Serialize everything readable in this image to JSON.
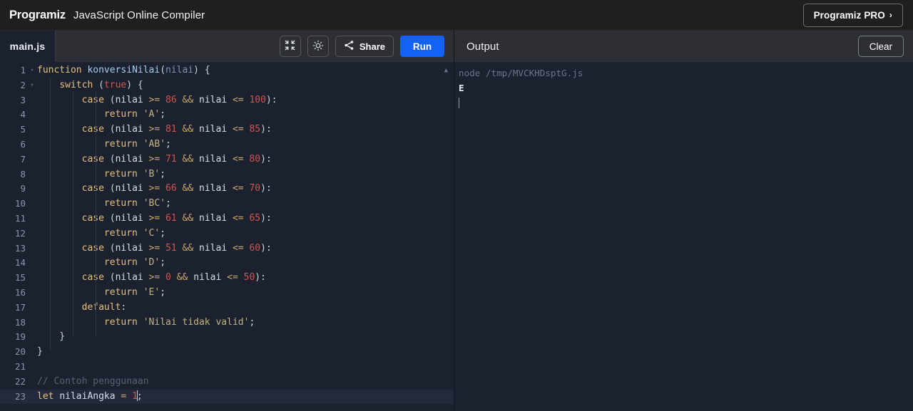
{
  "header": {
    "logo_text": "Programiz",
    "logo_icon": "programiz-flag-logo",
    "app_title": "JavaScript Online Compiler",
    "pro_button": "Programiz PRO",
    "pro_chevron": "›"
  },
  "editor_toolbar": {
    "file_tab": "main.js",
    "collapse_icon": "collapse-arrows-icon",
    "theme_icon": "brightness-sun-icon",
    "share_label": "Share",
    "share_icon": "share-nodes-icon",
    "run_label": "Run"
  },
  "output_panel": {
    "title": "Output",
    "clear_label": "Clear",
    "command_line": "node /tmp/MVCKHDsptG.js",
    "result_line": "E"
  },
  "editor": {
    "language": "javascript",
    "active_line": 23,
    "total_lines": 23,
    "lines": [
      {
        "n": 1,
        "fold": "▾",
        "tokens": [
          {
            "t": "function",
            "c": "kw"
          },
          {
            "t": " ",
            "c": "pun"
          },
          {
            "t": "konversiNilai",
            "c": "fn"
          },
          {
            "t": "(",
            "c": "pun"
          },
          {
            "t": "nilai",
            "c": "par"
          },
          {
            "t": ") {",
            "c": "pun"
          }
        ]
      },
      {
        "n": 2,
        "fold": "▾",
        "tokens": [
          {
            "t": "    ",
            "c": "pun"
          },
          {
            "t": "switch",
            "c": "kw"
          },
          {
            "t": " (",
            "c": "pun"
          },
          {
            "t": "true",
            "c": "tru"
          },
          {
            "t": ") {",
            "c": "pun"
          }
        ]
      },
      {
        "n": 3,
        "fold": "",
        "tokens": [
          {
            "t": "        ",
            "c": "pun"
          },
          {
            "t": "case",
            "c": "kw"
          },
          {
            "t": " (",
            "c": "pun"
          },
          {
            "t": "nilai",
            "c": "var"
          },
          {
            "t": " >= ",
            "c": "op"
          },
          {
            "t": "86",
            "c": "num"
          },
          {
            "t": " && ",
            "c": "op"
          },
          {
            "t": "nilai",
            "c": "var"
          },
          {
            "t": " <= ",
            "c": "op"
          },
          {
            "t": "100",
            "c": "num"
          },
          {
            "t": "):",
            "c": "pun"
          }
        ]
      },
      {
        "n": 4,
        "fold": "",
        "tokens": [
          {
            "t": "            ",
            "c": "pun"
          },
          {
            "t": "return",
            "c": "kw"
          },
          {
            "t": " ",
            "c": "pun"
          },
          {
            "t": "'A'",
            "c": "str"
          },
          {
            "t": ";",
            "c": "pun"
          }
        ]
      },
      {
        "n": 5,
        "fold": "",
        "tokens": [
          {
            "t": "        ",
            "c": "pun"
          },
          {
            "t": "case",
            "c": "kw"
          },
          {
            "t": " (",
            "c": "pun"
          },
          {
            "t": "nilai",
            "c": "var"
          },
          {
            "t": " >= ",
            "c": "op"
          },
          {
            "t": "81",
            "c": "num"
          },
          {
            "t": " && ",
            "c": "op"
          },
          {
            "t": "nilai",
            "c": "var"
          },
          {
            "t": " <= ",
            "c": "op"
          },
          {
            "t": "85",
            "c": "num"
          },
          {
            "t": "):",
            "c": "pun"
          }
        ]
      },
      {
        "n": 6,
        "fold": "",
        "tokens": [
          {
            "t": "            ",
            "c": "pun"
          },
          {
            "t": "return",
            "c": "kw"
          },
          {
            "t": " ",
            "c": "pun"
          },
          {
            "t": "'AB'",
            "c": "str"
          },
          {
            "t": ";",
            "c": "pun"
          }
        ]
      },
      {
        "n": 7,
        "fold": "",
        "tokens": [
          {
            "t": "        ",
            "c": "pun"
          },
          {
            "t": "case",
            "c": "kw"
          },
          {
            "t": " (",
            "c": "pun"
          },
          {
            "t": "nilai",
            "c": "var"
          },
          {
            "t": " >= ",
            "c": "op"
          },
          {
            "t": "71",
            "c": "num"
          },
          {
            "t": " && ",
            "c": "op"
          },
          {
            "t": "nilai",
            "c": "var"
          },
          {
            "t": " <= ",
            "c": "op"
          },
          {
            "t": "80",
            "c": "num"
          },
          {
            "t": "):",
            "c": "pun"
          }
        ]
      },
      {
        "n": 8,
        "fold": "",
        "tokens": [
          {
            "t": "            ",
            "c": "pun"
          },
          {
            "t": "return",
            "c": "kw"
          },
          {
            "t": " ",
            "c": "pun"
          },
          {
            "t": "'B'",
            "c": "str"
          },
          {
            "t": ";",
            "c": "pun"
          }
        ]
      },
      {
        "n": 9,
        "fold": "",
        "tokens": [
          {
            "t": "        ",
            "c": "pun"
          },
          {
            "t": "case",
            "c": "kw"
          },
          {
            "t": " (",
            "c": "pun"
          },
          {
            "t": "nilai",
            "c": "var"
          },
          {
            "t": " >= ",
            "c": "op"
          },
          {
            "t": "66",
            "c": "num"
          },
          {
            "t": " && ",
            "c": "op"
          },
          {
            "t": "nilai",
            "c": "var"
          },
          {
            "t": " <= ",
            "c": "op"
          },
          {
            "t": "70",
            "c": "num"
          },
          {
            "t": "):",
            "c": "pun"
          }
        ]
      },
      {
        "n": 10,
        "fold": "",
        "tokens": [
          {
            "t": "            ",
            "c": "pun"
          },
          {
            "t": "return",
            "c": "kw"
          },
          {
            "t": " ",
            "c": "pun"
          },
          {
            "t": "'BC'",
            "c": "str"
          },
          {
            "t": ";",
            "c": "pun"
          }
        ]
      },
      {
        "n": 11,
        "fold": "",
        "tokens": [
          {
            "t": "        ",
            "c": "pun"
          },
          {
            "t": "case",
            "c": "kw"
          },
          {
            "t": " (",
            "c": "pun"
          },
          {
            "t": "nilai",
            "c": "var"
          },
          {
            "t": " >= ",
            "c": "op"
          },
          {
            "t": "61",
            "c": "num"
          },
          {
            "t": " && ",
            "c": "op"
          },
          {
            "t": "nilai",
            "c": "var"
          },
          {
            "t": " <= ",
            "c": "op"
          },
          {
            "t": "65",
            "c": "num"
          },
          {
            "t": "):",
            "c": "pun"
          }
        ]
      },
      {
        "n": 12,
        "fold": "",
        "tokens": [
          {
            "t": "            ",
            "c": "pun"
          },
          {
            "t": "return",
            "c": "kw"
          },
          {
            "t": " ",
            "c": "pun"
          },
          {
            "t": "'C'",
            "c": "str"
          },
          {
            "t": ";",
            "c": "pun"
          }
        ]
      },
      {
        "n": 13,
        "fold": "",
        "tokens": [
          {
            "t": "        ",
            "c": "pun"
          },
          {
            "t": "case",
            "c": "kw"
          },
          {
            "t": " (",
            "c": "pun"
          },
          {
            "t": "nilai",
            "c": "var"
          },
          {
            "t": " >= ",
            "c": "op"
          },
          {
            "t": "51",
            "c": "num"
          },
          {
            "t": " && ",
            "c": "op"
          },
          {
            "t": "nilai",
            "c": "var"
          },
          {
            "t": " <= ",
            "c": "op"
          },
          {
            "t": "60",
            "c": "num"
          },
          {
            "t": "):",
            "c": "pun"
          }
        ]
      },
      {
        "n": 14,
        "fold": "",
        "tokens": [
          {
            "t": "            ",
            "c": "pun"
          },
          {
            "t": "return",
            "c": "kw"
          },
          {
            "t": " ",
            "c": "pun"
          },
          {
            "t": "'D'",
            "c": "str"
          },
          {
            "t": ";",
            "c": "pun"
          }
        ]
      },
      {
        "n": 15,
        "fold": "",
        "tokens": [
          {
            "t": "        ",
            "c": "pun"
          },
          {
            "t": "case",
            "c": "kw"
          },
          {
            "t": " (",
            "c": "pun"
          },
          {
            "t": "nilai",
            "c": "var"
          },
          {
            "t": " >= ",
            "c": "op"
          },
          {
            "t": "0",
            "c": "num"
          },
          {
            "t": " && ",
            "c": "op"
          },
          {
            "t": "nilai",
            "c": "var"
          },
          {
            "t": " <= ",
            "c": "op"
          },
          {
            "t": "50",
            "c": "num"
          },
          {
            "t": "):",
            "c": "pun"
          }
        ]
      },
      {
        "n": 16,
        "fold": "",
        "tokens": [
          {
            "t": "            ",
            "c": "pun"
          },
          {
            "t": "return",
            "c": "kw"
          },
          {
            "t": " ",
            "c": "pun"
          },
          {
            "t": "'E'",
            "c": "str"
          },
          {
            "t": ";",
            "c": "pun"
          }
        ]
      },
      {
        "n": 17,
        "fold": "",
        "tokens": [
          {
            "t": "        ",
            "c": "pun"
          },
          {
            "t": "default",
            "c": "kw"
          },
          {
            "t": ":",
            "c": "pun"
          }
        ]
      },
      {
        "n": 18,
        "fold": "",
        "tokens": [
          {
            "t": "            ",
            "c": "pun"
          },
          {
            "t": "return",
            "c": "kw"
          },
          {
            "t": " ",
            "c": "pun"
          },
          {
            "t": "'Nilai tidak valid'",
            "c": "str"
          },
          {
            "t": ";",
            "c": "pun"
          }
        ]
      },
      {
        "n": 19,
        "fold": "",
        "tokens": [
          {
            "t": "    }",
            "c": "pun"
          }
        ]
      },
      {
        "n": 20,
        "fold": "",
        "tokens": [
          {
            "t": "}",
            "c": "pun"
          }
        ]
      },
      {
        "n": 21,
        "fold": "",
        "tokens": []
      },
      {
        "n": 22,
        "fold": "",
        "tokens": [
          {
            "t": "// Contoh penggunaan",
            "c": "cmt"
          }
        ]
      },
      {
        "n": 23,
        "fold": "",
        "tokens": [
          {
            "t": "let",
            "c": "kw"
          },
          {
            "t": " ",
            "c": "pun"
          },
          {
            "t": "nilaiAngka",
            "c": "var"
          },
          {
            "t": " = ",
            "c": "op"
          },
          {
            "t": "1",
            "c": "num"
          },
          {
            "t": "|CURSOR|",
            "c": "cur"
          },
          {
            "t": ";",
            "c": "pun"
          }
        ]
      }
    ]
  },
  "colors": {
    "header_bg": "#201f1f",
    "toolbar_bg": "#2d2f34",
    "editor_bg": "#1c2130",
    "run_blue": "#1361f5",
    "active_line": "#242a3b"
  }
}
